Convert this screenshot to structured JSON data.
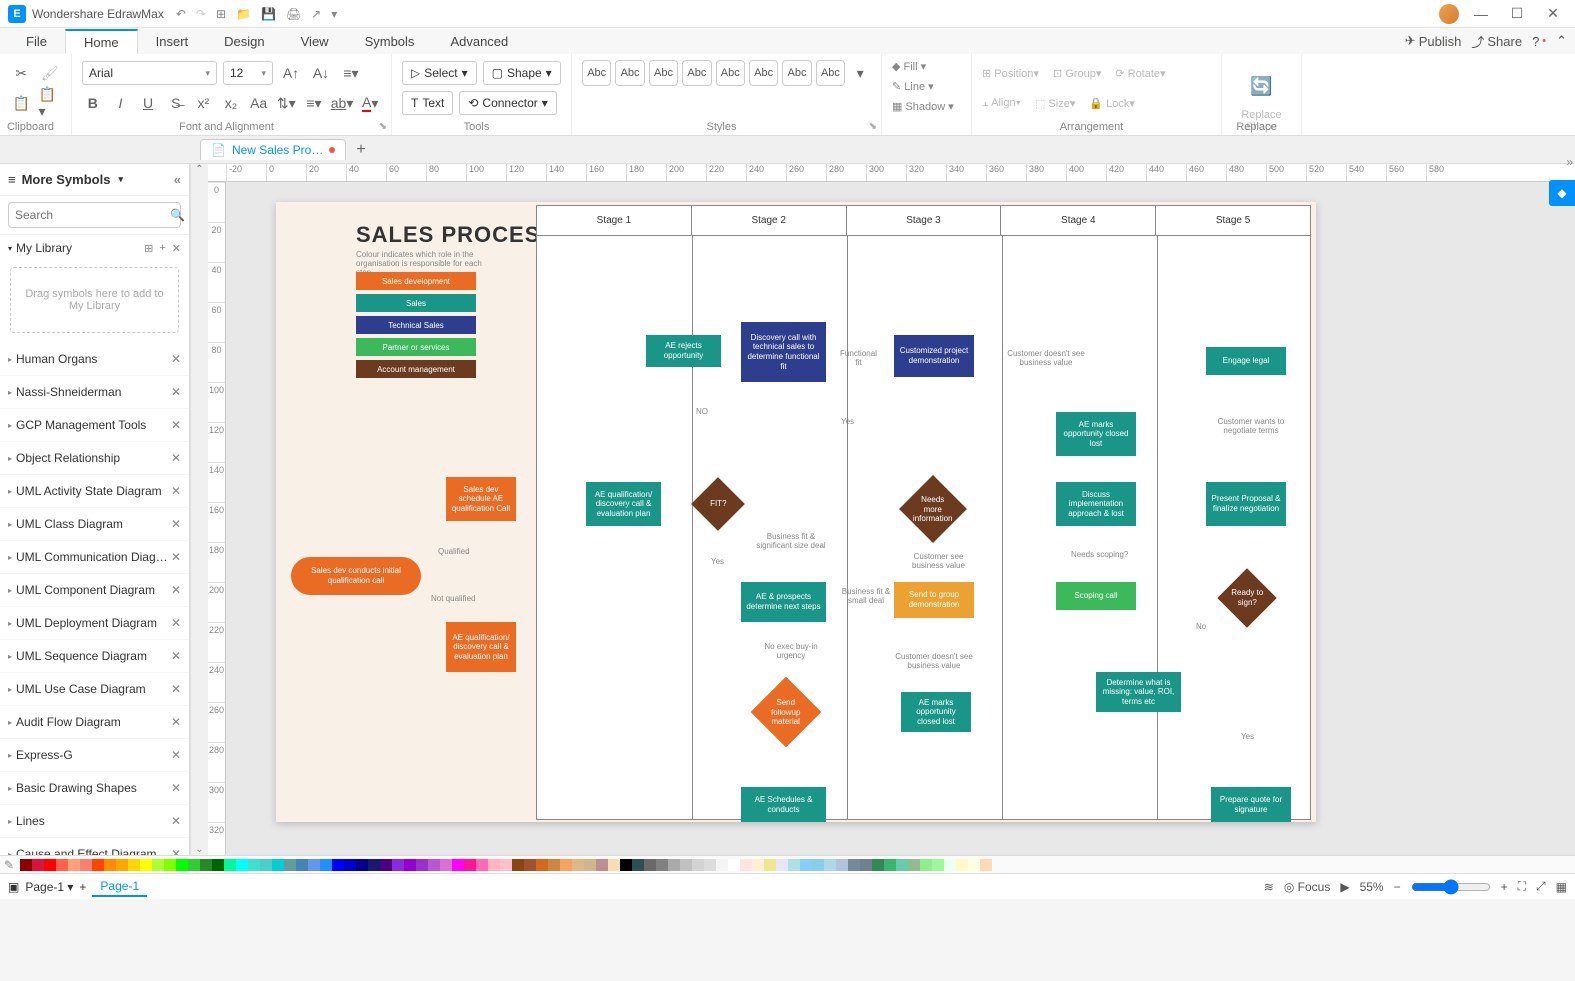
{
  "app": {
    "title": "Wondershare EdrawMax"
  },
  "menu": {
    "items": [
      "File",
      "Home",
      "Insert",
      "Design",
      "View",
      "Symbols",
      "Advanced"
    ],
    "active": 1,
    "publish": "Publish",
    "share": "Share"
  },
  "ribbon": {
    "clipboard": "Clipboard",
    "fontalign": "Font and Alignment",
    "tools": "Tools",
    "styles": "Styles",
    "arrangement": "Arrangement",
    "replace": "Replace",
    "font": "Arial",
    "size": "12",
    "select": "Select",
    "shape": "Shape",
    "text": "Text",
    "connector": "Connector",
    "fill": "Fill",
    "line": "Line",
    "shadow": "Shadow",
    "position": "Position",
    "group": "Group",
    "rotate": "Rotate",
    "align": "Align",
    "sizeBtn": "Size",
    "lock": "Lock",
    "replaceShape": "Replace\nShape",
    "styleSample": "Abc"
  },
  "doc": {
    "tab": "New Sales Pro…"
  },
  "sidebar": {
    "title": "More Symbols",
    "search": "Search",
    "mylib": "My Library",
    "dropzone": "Drag symbols here to add to My Library",
    "categories": [
      "Human Organs",
      "Nassi-Shneiderman",
      "GCP Management Tools",
      "Object Relationship",
      "UML Activity State Diagram",
      "UML Class Diagram",
      "UML Communication Diagr…",
      "UML Component Diagram",
      "UML Deployment Diagram",
      "UML Sequence Diagram",
      "UML Use Case Diagram",
      "Audit Flow Diagram",
      "Express-G",
      "Basic Drawing Shapes",
      "Lines",
      "Cause and Effect Diagram"
    ]
  },
  "flow": {
    "title": "SALES PROCESS",
    "subtitle": "Colour indicates which role in the organisation is responsible for each step",
    "stages": [
      "Stage 1",
      "Stage 2",
      "Stage 3",
      "Stage 4",
      "Stage 5"
    ],
    "legend": [
      "Sales development",
      "Sales",
      "Technical Sales",
      "Partner or services",
      "Account management"
    ],
    "shapes": {
      "s1": "Sales dev conducts initial qualification call",
      "s2": "Sales dev schedule AE qualification Call",
      "s3": "AE qualification/ discovery call & evaluation plan",
      "s4": "AE qualification/ discovery call & evaluation plan",
      "s5": "AE rejects opportunity",
      "s6": "FIT?",
      "s7": "Discovery call with technical sales to determine functional fit",
      "s8": "AE & prospects determine next steps",
      "s9": "Send followup material",
      "s10": "AE Schedules & conducts",
      "s11": "Customized project demonstration",
      "s12": "Needs more information",
      "s13": "Send to group demonstration",
      "s14": "AE marks opportunity closed lost",
      "s15": "AE marks opportunity closed lost",
      "s16": "Discuss implementation approach & lost",
      "s17": "Scoping call",
      "s18": "Determine what is missing: value, ROI, terms etc",
      "s19": "Engage legal",
      "s20": "Present Proposal & finalize negotiation",
      "s21": "Ready to sign?",
      "s22": "Prepare quote for signature"
    },
    "labels": {
      "qualified": "Qualified",
      "notqualified": "Not qualified",
      "no": "NO",
      "yes": "Yes",
      "yes2": "Yes",
      "no2": "No",
      "funcfit": "Functional fit",
      "bizfit": "Business fit & significant size deal",
      "bizfitsmall": "Business fit & small deal",
      "noexec": "No exec buy-in urgency",
      "custsee": "Customer see business value",
      "custnosee": "Customer doesn't see business value",
      "custnosee2": "Customer doesn't see business value",
      "needsscoping": "Needs scoping?",
      "custwants": "Customer wants to negotiate terms",
      "yes3": "Yes"
    }
  },
  "status": {
    "page": "Page-1",
    "pagetab": "Page-1",
    "focus": "Focus",
    "zoom": "55%"
  },
  "ruler": {
    "h": [
      "-20",
      "0",
      "20",
      "40",
      "60",
      "80",
      "100",
      "120",
      "140",
      "160",
      "180",
      "200",
      "220",
      "240",
      "260",
      "280",
      "300",
      "320",
      "340",
      "360",
      "380",
      "400",
      "420",
      "440",
      "460",
      "480",
      "500",
      "520",
      "540",
      "560",
      "580"
    ],
    "v": [
      "0",
      "20",
      "40",
      "60",
      "80",
      "100",
      "120",
      "140",
      "160",
      "180",
      "200",
      "220",
      "240",
      "260",
      "280",
      "300",
      "320"
    ]
  },
  "colors": [
    "#8B0000",
    "#DC143C",
    "#FF0000",
    "#FF6347",
    "#FFA07A",
    "#FA8072",
    "#FF4500",
    "#FF8C00",
    "#FFA500",
    "#FFD700",
    "#FFFF00",
    "#ADFF2F",
    "#7FFF00",
    "#00FF00",
    "#32CD32",
    "#228B22",
    "#006400",
    "#00FA9A",
    "#00FFFF",
    "#40E0D0",
    "#48D1CC",
    "#00CED1",
    "#5F9EA0",
    "#4682B4",
    "#6495ED",
    "#1E90FF",
    "#0000FF",
    "#0000CD",
    "#00008B",
    "#191970",
    "#4B0082",
    "#8A2BE2",
    "#9400D3",
    "#9932CC",
    "#BA55D3",
    "#DA70D6",
    "#FF00FF",
    "#FF1493",
    "#FF69B4",
    "#FFB6C1",
    "#FFC0CB",
    "#8B4513",
    "#A0522D",
    "#D2691E",
    "#CD853F",
    "#F4A460",
    "#DEB887",
    "#D2B48C",
    "#BC8F8F",
    "#F5DEB3",
    "#000000",
    "#2F4F4F",
    "#696969",
    "#808080",
    "#A9A9A9",
    "#C0C0C0",
    "#D3D3D3",
    "#DCDCDC",
    "#F5F5F5",
    "#FFFFFF",
    "#FFE4E1",
    "#FFEFD5",
    "#F0E68C",
    "#E6E6FA",
    "#B0E0E6",
    "#87CEFA",
    "#87CEEB",
    "#ADD8E6",
    "#B0C4DE",
    "#778899",
    "#708090",
    "#2E8B57",
    "#3CB371",
    "#66CDAA",
    "#8FBC8F",
    "#90EE90",
    "#98FB98",
    "#F0FFF0",
    "#FFFACD",
    "#FFFFE0",
    "#FFDAB9"
  ]
}
